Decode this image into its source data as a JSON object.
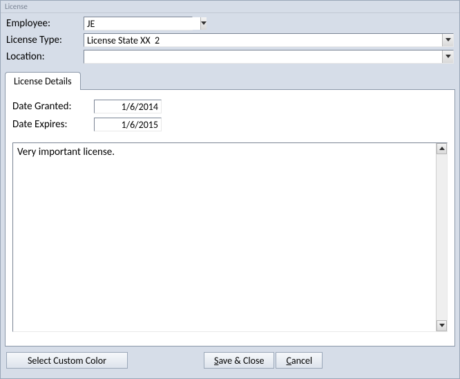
{
  "window": {
    "title": "License"
  },
  "form": {
    "employee_label": "Employee:",
    "employee_value": "JE",
    "license_type_label": "License Type:",
    "license_type_value": "License State XX  2",
    "location_label": "Location:",
    "location_value": ""
  },
  "tabs": {
    "details_label": "License Details"
  },
  "details": {
    "date_granted_label": "Date Granted:",
    "date_granted_value": "1/6/2014",
    "date_expires_label": "Date Expires:",
    "date_expires_value": "1/6/2015",
    "notes": "Very important license."
  },
  "buttons": {
    "custom_color": "Select Custom Color",
    "save_close_pre": "S",
    "save_close_post": "ave & Close",
    "cancel_pre": "C",
    "cancel_post": "ancel"
  }
}
